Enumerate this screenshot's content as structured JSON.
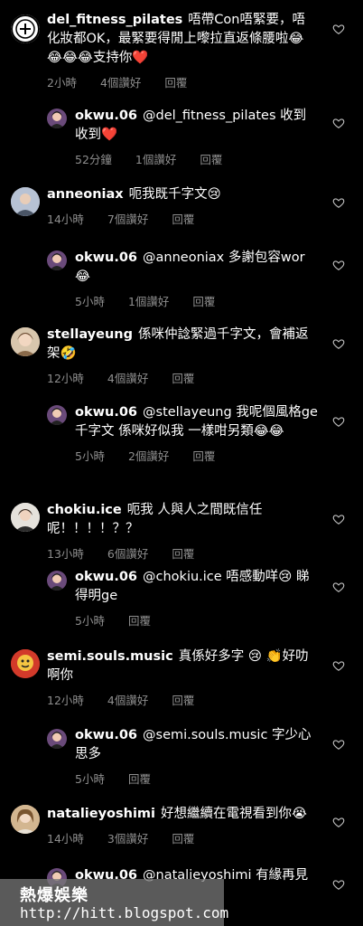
{
  "comments": [
    {
      "user": "del_fitness_pilates",
      "text": "唔帶Con唔緊要，唔化妝都OK，最緊要得閒上嚟拉直返條腰啦😂😂😂😂支持你❤️",
      "time": "2小時",
      "likes": "4個讚好",
      "reply_label": "回覆",
      "avatar": "del_fitness_pilates-logo"
    },
    {
      "user": "okwu.06",
      "text": "@del_fitness_pilates 收到收到❤️",
      "time": "52分鐘",
      "likes": "1個讚好",
      "reply_label": "回覆",
      "avatar": "okwu-avatar"
    },
    {
      "user": "anneoniax",
      "text": "呃我既千字文😢",
      "time": "14小時",
      "likes": "7個讚好",
      "reply_label": "回覆",
      "avatar": "anneoniax-avatar"
    },
    {
      "user": "okwu.06",
      "text": "@anneoniax 多謝包容wor😂",
      "time": "5小時",
      "likes": "1個讚好",
      "reply_label": "回覆",
      "avatar": "okwu-avatar"
    },
    {
      "user": "stellayeung",
      "text": "係咪仲諗緊過千字文，會補返架🤣",
      "time": "12小時",
      "likes": "4個讚好",
      "reply_label": "回覆",
      "avatar": "stellayeung-avatar"
    },
    {
      "user": "okwu.06",
      "text": "@stellayeung 我呢個風格ge千字文 係咪好似我 一樣咁另類😂😂",
      "time": "5小時",
      "likes": "2個讚好",
      "reply_label": "回覆",
      "avatar": "okwu-avatar"
    },
    {
      "user": "chokiu.ice",
      "text": "呃我 人與人之間既信任呢！！！！？？",
      "time": "13小時",
      "likes": "6個讚好",
      "reply_label": "回覆",
      "avatar": "chokiu-avatar"
    },
    {
      "user": "okwu.06",
      "text": "@chokiu.ice 唔感動咩😢 睇得明ge",
      "time": "5小時",
      "likes": "",
      "reply_label": "回覆",
      "avatar": "okwu-avatar"
    },
    {
      "user": "semi.souls.music",
      "text": "真係好多字 😢 👏好叻啊你",
      "time": "12小時",
      "likes": "4個讚好",
      "reply_label": "回覆",
      "avatar": "semi-avatar"
    },
    {
      "user": "okwu.06",
      "text": "@semi.souls.music 字少心思多",
      "time": "5小時",
      "likes": "",
      "reply_label": "回覆",
      "avatar": "okwu-avatar"
    },
    {
      "user": "natalieyoshimi",
      "text": "好想繼續在電視看到你😭",
      "time": "14小時",
      "likes": "3個讚好",
      "reply_label": "回覆",
      "avatar": "natalie-avatar"
    },
    {
      "user": "okwu.06",
      "text": "@natalieyoshimi 有緣再見",
      "time": "",
      "likes": "",
      "reply_label": "",
      "avatar": "okwu-avatar"
    }
  ],
  "watermark": {
    "title": "熱爆娛樂",
    "url": "http://hitt.blogspot.com"
  },
  "colors": {
    "background": "#000000",
    "text": "#ffffff",
    "meta": "#8e8e8e"
  }
}
